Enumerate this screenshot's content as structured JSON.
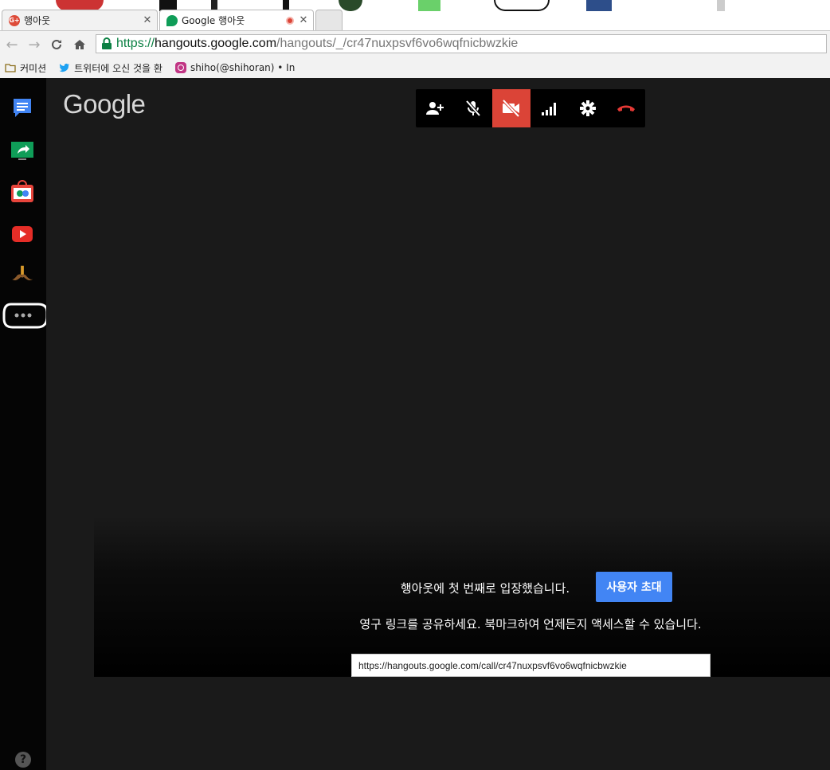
{
  "browser": {
    "tabs": [
      {
        "title": "행아웃",
        "favicon": "google-plus-icon",
        "active": false
      },
      {
        "title": "Google 행아웃",
        "favicon": "hangouts-icon",
        "active": true,
        "recording": true
      }
    ],
    "url": {
      "scheme": "https://",
      "host": "hangouts.google.com",
      "path": "/hangouts/_/cr47nuxpsvf6vo6wqfnicbwzkie"
    },
    "bookmarks": [
      {
        "label": "커미션",
        "icon": "folder-icon"
      },
      {
        "label": "트위터에 오신 것을 환",
        "icon": "twitter-icon"
      },
      {
        "label": "shiho(@shihoran) • In",
        "icon": "instagram-icon"
      }
    ]
  },
  "app": {
    "logo": "Google",
    "sidebar_icons": [
      "chat-icon",
      "screenshare-icon",
      "app-store-icon",
      "youtube-icon",
      "mustache-icon",
      "more-icon"
    ],
    "help_icon": "?",
    "callbar": [
      "add-person-icon",
      "mic-off-icon",
      "video-off-icon",
      "signal-icon",
      "settings-icon",
      "hangup-icon"
    ],
    "first_msg": "행아웃에 첫 번째로 입장했습니다.",
    "invite_label": "사용자 초대",
    "share_msg": "영구 링크를 공유하세요. 북마크하여 언제든지 액세스할 수 있습니다.",
    "permalink": "https://hangouts.google.com/call/cr47nuxpsvf6vo6wqfnicbwzkie",
    "colors": {
      "accent": "#4285f4",
      "active_red": "#db4437",
      "hangup_red": "#e53935"
    }
  }
}
